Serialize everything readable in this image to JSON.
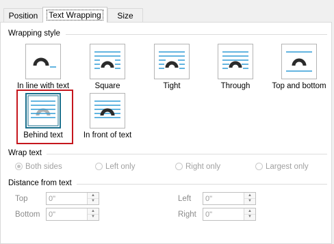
{
  "tabs": [
    {
      "label": "Position"
    },
    {
      "label": "Text Wrapping"
    },
    {
      "label": "Size"
    }
  ],
  "wrapping_style": {
    "heading": "Wrapping style",
    "options": [
      {
        "label": "In line with text",
        "icon": "inline-with-text-icon"
      },
      {
        "label": "Square",
        "icon": "square-wrap-icon"
      },
      {
        "label": "Tight",
        "icon": "tight-wrap-icon"
      },
      {
        "label": "Through",
        "icon": "through-wrap-icon"
      },
      {
        "label": "Top and bottom",
        "icon": "top-bottom-wrap-icon"
      },
      {
        "label": "Behind text",
        "icon": "behind-text-icon",
        "selected": true
      },
      {
        "label": "In front of text",
        "icon": "in-front-of-text-icon"
      }
    ]
  },
  "wrap_text": {
    "heading": "Wrap text",
    "options": [
      {
        "label": "Both sides",
        "checked": true
      },
      {
        "label": "Left only",
        "checked": false
      },
      {
        "label": "Right only",
        "checked": false
      },
      {
        "label": "Largest only",
        "checked": false
      }
    ]
  },
  "distance": {
    "heading": "Distance from text",
    "top_label": "Top",
    "bottom_label": "Bottom",
    "left_label": "Left",
    "right_label": "Right",
    "top_value": "0\"",
    "bottom_value": "0\"",
    "left_value": "0\"",
    "right_value": "0\""
  },
  "colors": {
    "line_blue": "#2e9bd6",
    "image_dark": "#2b2b2b",
    "image_behind": "#b0b0b0",
    "selected_outline": "#c5161d",
    "selected_box": "#1a6f8c"
  }
}
